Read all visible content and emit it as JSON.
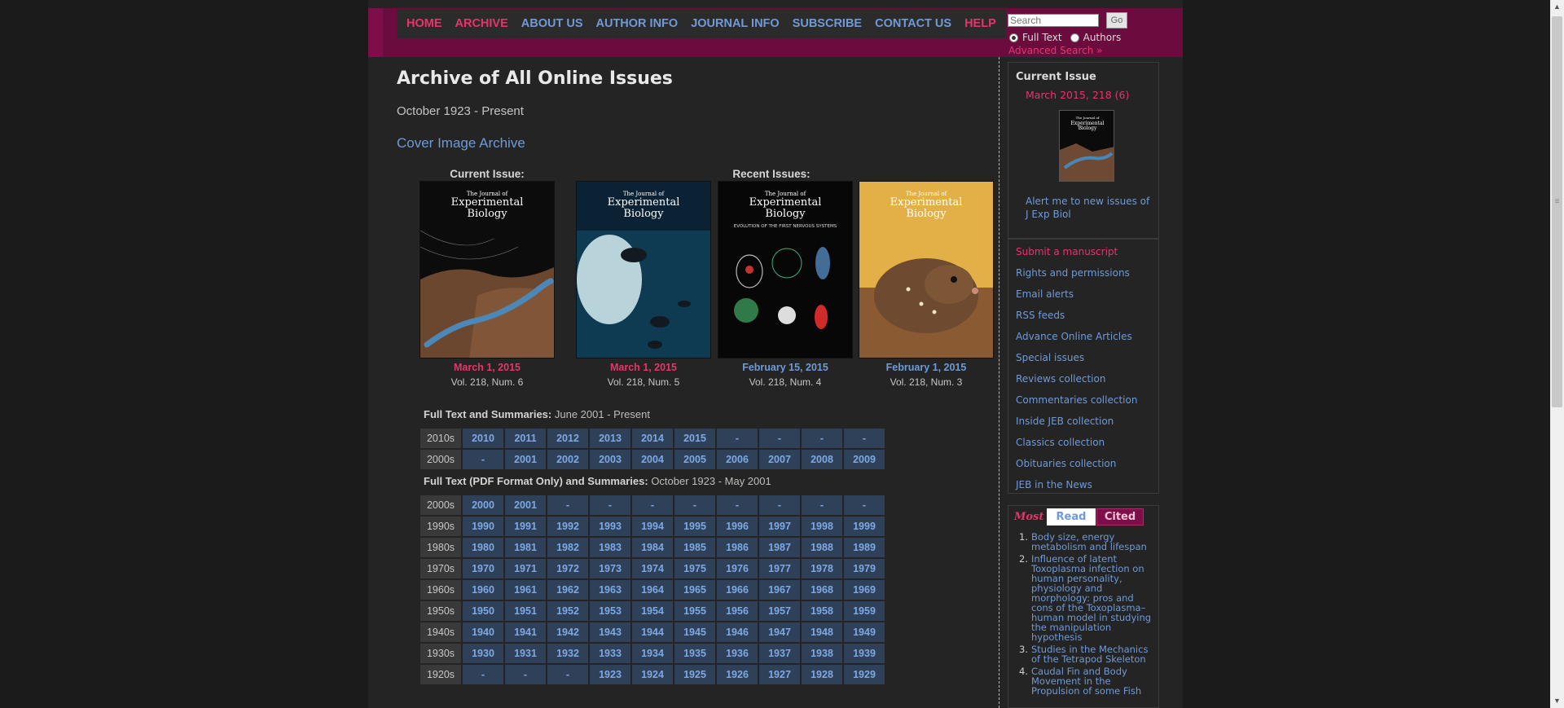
{
  "nav": {
    "items": [
      {
        "label": "HOME",
        "pink": true
      },
      {
        "label": "ARCHIVE",
        "pink": true
      },
      {
        "label": "ABOUT US",
        "pink": false
      },
      {
        "label": "AUTHOR INFO",
        "pink": false
      },
      {
        "label": "JOURNAL INFO",
        "pink": false
      },
      {
        "label": "SUBSCRIBE",
        "pink": false
      },
      {
        "label": "CONTACT US",
        "pink": false
      },
      {
        "label": "HELP",
        "pink": true
      }
    ]
  },
  "search": {
    "placeholder": "Search",
    "go_label": "Go",
    "option_full_text": "Full Text",
    "option_authors": "Authors",
    "advanced_label": "Advanced Search »"
  },
  "main": {
    "title": "Archive of All Online Issues",
    "date_range": "October 1923 - Present",
    "cover_archive": "Cover Image Archive",
    "current_issue_heading": "Current Issue:",
    "recent_issues_heading": "Recent Issues:",
    "cover_brand_top": "The Journal of",
    "cover_brand_main": [
      "Experimental",
      "Biology"
    ],
    "cover_3_caption": "EVOLUTION OF THE FIRST NERVOUS SYSTEMS",
    "covers": [
      {
        "date": "March 1, 2015",
        "vol": "Vol. 218, Num. 6",
        "date_color": "#e8346d"
      },
      {
        "date": "March 1, 2015",
        "vol": "Vol. 218, Num. 5",
        "date_color": "#e8346d"
      },
      {
        "date": "February 15, 2015",
        "vol": "Vol. 218, Num. 4",
        "date_color": "#6f9ad6"
      },
      {
        "date": "February 1, 2015",
        "vol": "Vol. 218, Num. 3",
        "date_color": "#6f9ad6"
      }
    ],
    "full_text_label": "Full Text and Summaries:",
    "full_text_range": "June 2001 - Present",
    "full_text_rows": [
      {
        "decade": "2010s",
        "years": [
          "2010",
          "2011",
          "2012",
          "2013",
          "2014",
          "2015",
          "-",
          "-",
          "-",
          "-"
        ]
      },
      {
        "decade": "2000s",
        "years": [
          "-",
          "2001",
          "2002",
          "2003",
          "2004",
          "2005",
          "2006",
          "2007",
          "2008",
          "2009"
        ]
      }
    ],
    "pdf_label": "Full Text (PDF Format Only) and Summaries:",
    "pdf_range": "October 1923 - May 2001",
    "pdf_rows": [
      {
        "decade": "2000s",
        "years": [
          "2000",
          "2001",
          "-",
          "-",
          "-",
          "-",
          "-",
          "-",
          "-",
          "-"
        ]
      },
      {
        "decade": "1990s",
        "years": [
          "1990",
          "1991",
          "1992",
          "1993",
          "1994",
          "1995",
          "1996",
          "1997",
          "1998",
          "1999"
        ]
      },
      {
        "decade": "1980s",
        "years": [
          "1980",
          "1981",
          "1982",
          "1983",
          "1984",
          "1985",
          "1986",
          "1987",
          "1988",
          "1989"
        ]
      },
      {
        "decade": "1970s",
        "years": [
          "1970",
          "1971",
          "1972",
          "1973",
          "1974",
          "1975",
          "1976",
          "1977",
          "1978",
          "1979"
        ]
      },
      {
        "decade": "1960s",
        "years": [
          "1960",
          "1961",
          "1962",
          "1963",
          "1964",
          "1965",
          "1966",
          "1967",
          "1968",
          "1969"
        ]
      },
      {
        "decade": "1950s",
        "years": [
          "1950",
          "1951",
          "1952",
          "1953",
          "1954",
          "1955",
          "1956",
          "1957",
          "1958",
          "1959"
        ]
      },
      {
        "decade": "1940s",
        "years": [
          "1940",
          "1941",
          "1942",
          "1943",
          "1944",
          "1945",
          "1946",
          "1947",
          "1948",
          "1949"
        ]
      },
      {
        "decade": "1930s",
        "years": [
          "1930",
          "1931",
          "1932",
          "1933",
          "1934",
          "1935",
          "1936",
          "1937",
          "1938",
          "1939"
        ]
      },
      {
        "decade": "1920s",
        "years": [
          "-",
          "-",
          "-",
          "1923",
          "1924",
          "1925",
          "1926",
          "1927",
          "1928",
          "1929"
        ]
      }
    ]
  },
  "sidebar": {
    "current_title": "Current Issue",
    "current_issue_link": "March 2015, 218 (6)",
    "alert_link": "Alert me to new issues of J Exp Biol",
    "links": [
      {
        "label": "Submit a manuscript",
        "pink": true
      },
      {
        "label": "Rights and permissions",
        "pink": false
      },
      {
        "label": "Email alerts",
        "pink": false
      },
      {
        "label": "RSS feeds",
        "pink": false
      },
      {
        "label": "Advance Online Articles",
        "pink": false
      },
      {
        "label": "Special issues",
        "pink": false
      },
      {
        "label": "Reviews collection",
        "pink": false
      },
      {
        "label": "Commentaries collection",
        "pink": false
      },
      {
        "label": "Inside JEB collection",
        "pink": false
      },
      {
        "label": "Classics collection",
        "pink": false
      },
      {
        "label": "Obituaries collection",
        "pink": false
      },
      {
        "label": "JEB in the News",
        "pink": false
      }
    ],
    "most": {
      "label": "Most",
      "tab_read": "Read",
      "tab_cited": "Cited",
      "items": [
        {
          "num": "1.",
          "title": "Body size, energy metabolism and lifespan"
        },
        {
          "num": "2.",
          "title": "Influence of latent Toxoplasma infection on human personality, physiology and morphology: pros and cons of the Toxoplasma–human model in studying the manipulation hypothesis"
        },
        {
          "num": "3.",
          "title": "Studies in the Mechanics of the Tetrapod Skeleton"
        },
        {
          "num": "4.",
          "title": "Caudal Fin and Body Movement in the Propulsion of some Fish"
        }
      ]
    }
  },
  "colors": {
    "header": "#6b0b3e",
    "link_blue": "#6f9ad6",
    "link_pink": "#e8346d",
    "year_cell": "#2f4159"
  }
}
